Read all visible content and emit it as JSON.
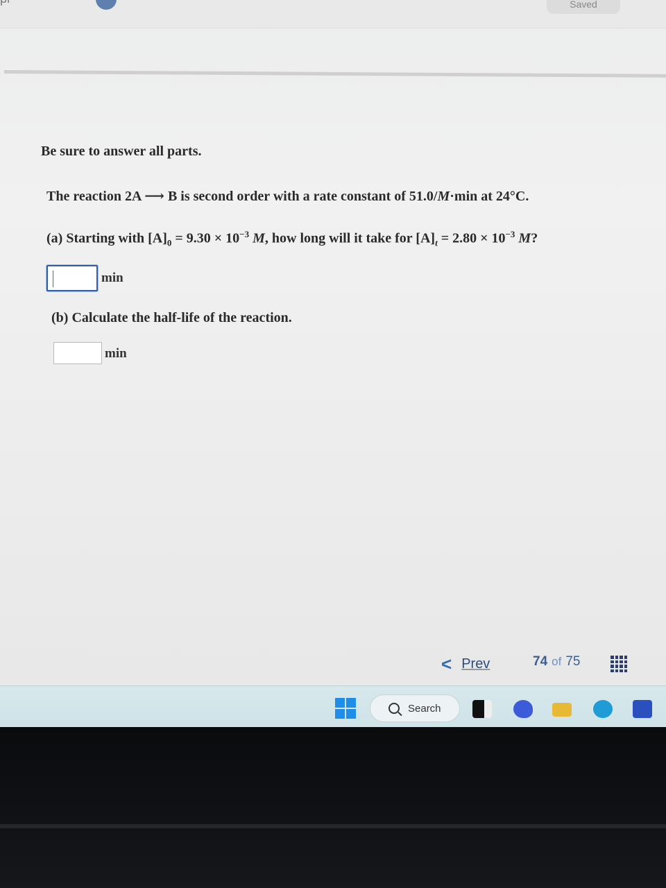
{
  "header": {
    "partial_title": "pr",
    "saved_label": "Saved"
  },
  "question": {
    "instruction": "Be sure to answer all parts.",
    "reaction_text_1": "The reaction 2A ",
    "arrow": "⟶",
    "reaction_text_2": " B is second order with a rate constant of 51.0/",
    "reaction_M": "M",
    "reaction_text_3": "·min at 24°C.",
    "part_a": {
      "prefix": "(a) Starting with [A]",
      "sub_0": "0",
      "eq1": " = 9.30 × 10",
      "exp1": "−3",
      "m1": " M",
      "middle": ", how long will it take for [A]",
      "sub_t": "t",
      "eq2": " = 2.80 × 10",
      "exp2": "−3",
      "m2": " M",
      "end": "?",
      "unit": "min",
      "value": ""
    },
    "part_b": {
      "text": "(b) Calculate the half-life of the reaction.",
      "unit": "min",
      "value": ""
    }
  },
  "navigation": {
    "prev_label": "Prev",
    "current_page": "74",
    "of_label": "of",
    "total_pages": "75"
  },
  "taskbar": {
    "search_label": "Search"
  },
  "colors": {
    "accent": "#2e6db4",
    "taskbar": "#d3e6ea",
    "windows_blue": "#1e8ee8"
  }
}
